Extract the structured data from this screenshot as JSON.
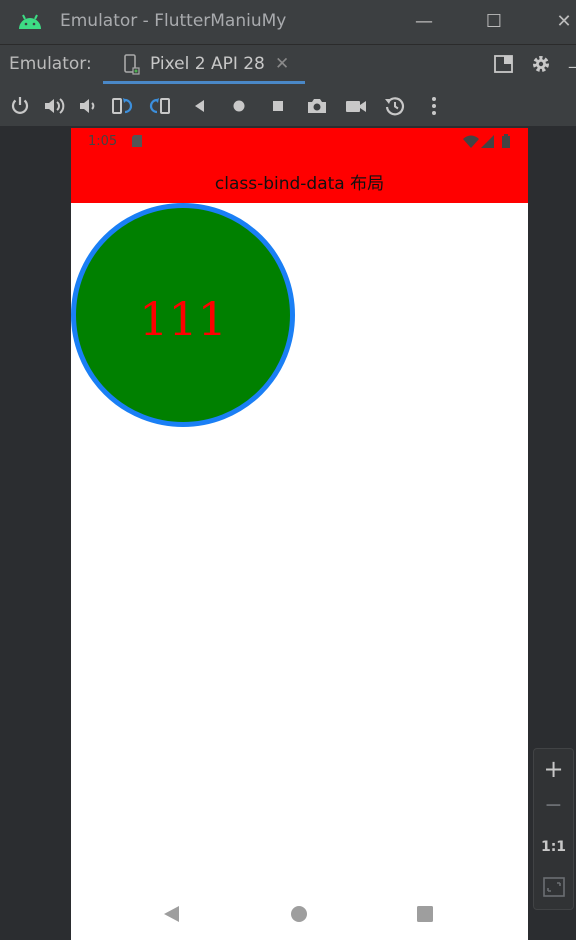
{
  "window": {
    "title": "Emulator - FlutterManiuMy",
    "minimize": "—",
    "maximize": "☐",
    "close": "✕"
  },
  "tabbar": {
    "label": "Emulator:",
    "tab_label": "Pixel 2 API 28",
    "tab_close": "✕"
  },
  "device": {
    "status_time": "1:05",
    "app_title": "class-bind-data 布局",
    "circle_text": "111",
    "colors": {
      "appbar": "#ff0000",
      "circle_fill": "#008000",
      "circle_border": "#1a7ff5",
      "circle_text": "#ff0000"
    }
  },
  "zoom": {
    "zoom_in": "+",
    "zoom_out": "−",
    "actual_size": "1:1"
  }
}
